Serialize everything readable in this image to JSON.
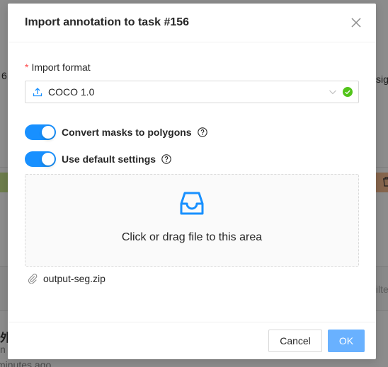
{
  "background": {
    "left_fragment": "6",
    "right_fragment": "sig",
    "filter_fragment": "filte",
    "card_title_fragment": "外",
    "card_sub_fragment": "n",
    "time_fragment": "minutes ago"
  },
  "modal": {
    "title": "Import annotation to task #156",
    "close_icon": "close-icon",
    "format_label": "Import format",
    "required_mark": "*",
    "format_value": "COCO 1.0",
    "switches": [
      {
        "label": "Convert masks to polygons",
        "checked": true
      },
      {
        "label": "Use default settings",
        "checked": true
      }
    ],
    "dropzone_text": "Click or drag file to this area",
    "file_name": "output-seg.zip",
    "cancel_label": "Cancel",
    "ok_label": "OK"
  },
  "colors": {
    "primary": "#1890ff",
    "ok_button": "#69b1ff",
    "success": "#52c41a",
    "required": "#ff4d4f"
  }
}
